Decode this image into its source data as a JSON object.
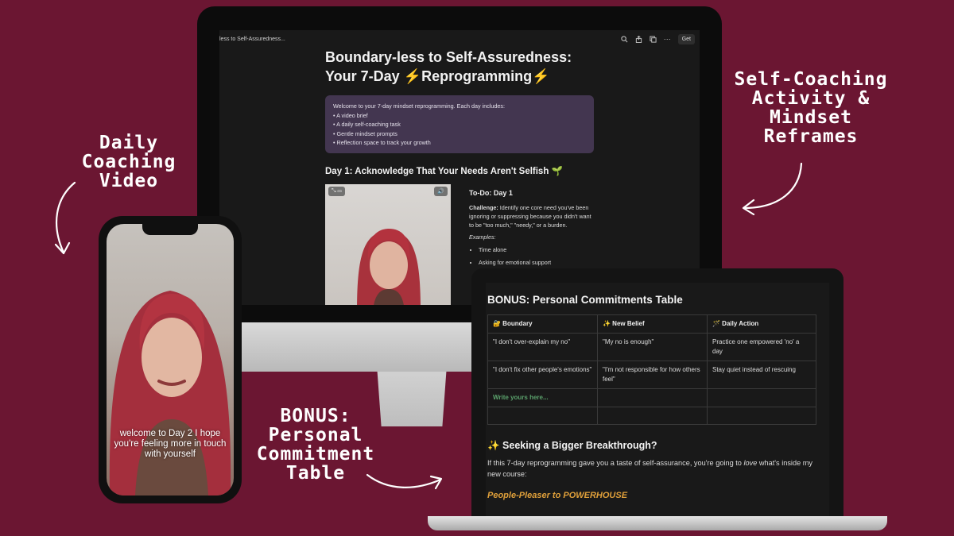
{
  "labels": {
    "daily_video": [
      "Daily",
      "Coaching",
      "Video"
    ],
    "self_coaching": [
      "Self-Coaching",
      "Activity &",
      "Mindset",
      "Reframes"
    ],
    "bonus": [
      "BONUS:",
      "Personal",
      "Commitment",
      "Table"
    ]
  },
  "monitor": {
    "breadcrumb": "less to Self-Assuredness...",
    "get_label": "Get",
    "title_line1": "Boundary-less to Self-Assuredness:",
    "title_line2": "Your 7-Day ⚡Reprogramming⚡",
    "callout": {
      "intro": "Welcome to your 7-day mindset reprogramming. Each day includes:",
      "items": [
        "A video brief",
        "A daily self-coaching task",
        "Gentle mindset prompts",
        "Reflection space to track your growth"
      ]
    },
    "day_heading": "Day 1: Acknowledge That Your Needs Aren't Selfish 🌱",
    "todo": {
      "heading": "To-Do: Day 1",
      "challenge_label": "Challenge:",
      "challenge_text": " Identify one core need you've been ignoring or suppressing because you didn't want to be \"too much,\" \"needy,\" or a burden.",
      "examples_label": "Examples:",
      "examples": [
        "Time alone",
        "Asking for emotional support"
      ]
    }
  },
  "phone": {
    "caption": "welcome to Day 2 I hope you're feeling more in touch with yourself"
  },
  "laptop": {
    "title": "BONUS: Personal Commitments Table",
    "headers": [
      "🔐 Boundary",
      "✨ New Belief",
      "🪄 Daily Action"
    ],
    "rows": [
      [
        "\"I don't over-explain my no\"",
        "\"My no is enough\"",
        "Practice one empowered 'no' a day"
      ],
      [
        "\"I don't fix other people's emotions\"",
        "\"I'm not responsible for how others feel\"",
        "Stay quiet instead of rescuing"
      ]
    ],
    "placeholder": "Write yours here...",
    "seek_heading": "✨ Seeking a Bigger Breakthrough?",
    "para_before": "If this 7-day reprogramming gave you a taste of self-assurance, you're going to ",
    "para_em": "love",
    "para_after": " what's inside my new course:",
    "course": "People-Pleaser to POWERHOUSE"
  },
  "colors": {
    "background": "#6b1632",
    "callout": "#433650",
    "course": "#e0a03a",
    "placeholder": "#5aa06b"
  }
}
